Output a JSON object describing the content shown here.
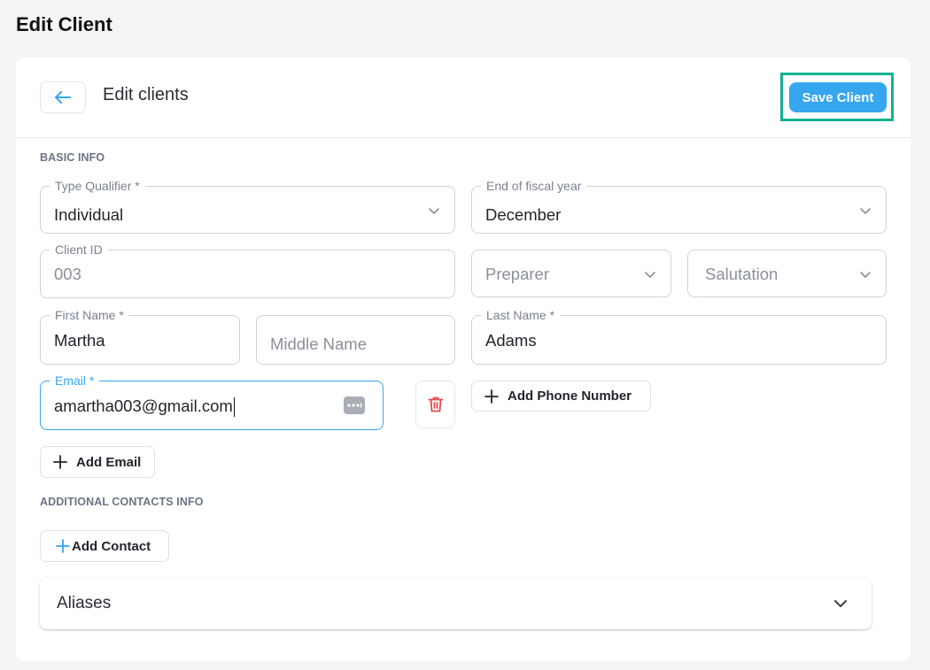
{
  "page": {
    "title": "Edit Client"
  },
  "header": {
    "title": "Edit clients",
    "save_label": "Save Client"
  },
  "sections": {
    "basic_info": "BASIC INFO",
    "additional_contacts": "ADDITIONAL CONTACTS INFO"
  },
  "fields": {
    "type_qualifier": {
      "label": "Type Qualifier *",
      "value": "Individual"
    },
    "fiscal_year_end": {
      "label": "End of fiscal year",
      "value": "December"
    },
    "client_id": {
      "label": "Client ID",
      "value": "003"
    },
    "preparer": {
      "placeholder": "Preparer"
    },
    "salutation": {
      "placeholder": "Salutation"
    },
    "first_name": {
      "label": "First Name *",
      "value": "Martha"
    },
    "middle_name": {
      "placeholder": "Middle Name"
    },
    "last_name": {
      "label": "Last Name *",
      "value": "Adams"
    },
    "email": {
      "label": "Email *",
      "value": "amartha003@gmail.com"
    }
  },
  "buttons": {
    "add_phone": "Add Phone Number",
    "add_email": "Add Email",
    "add_contact": "Add Contact"
  },
  "aliases": {
    "label": "Aliases"
  },
  "icons": {
    "back": "arrow-left-icon",
    "chevron": "chevron-down-icon",
    "trash": "trash-icon",
    "plus": "plus-icon",
    "password_manager": "password-manager-icon"
  },
  "colors": {
    "accent": "#36a6ef",
    "highlight_outline": "#14b28f",
    "danger": "#e5484d"
  }
}
